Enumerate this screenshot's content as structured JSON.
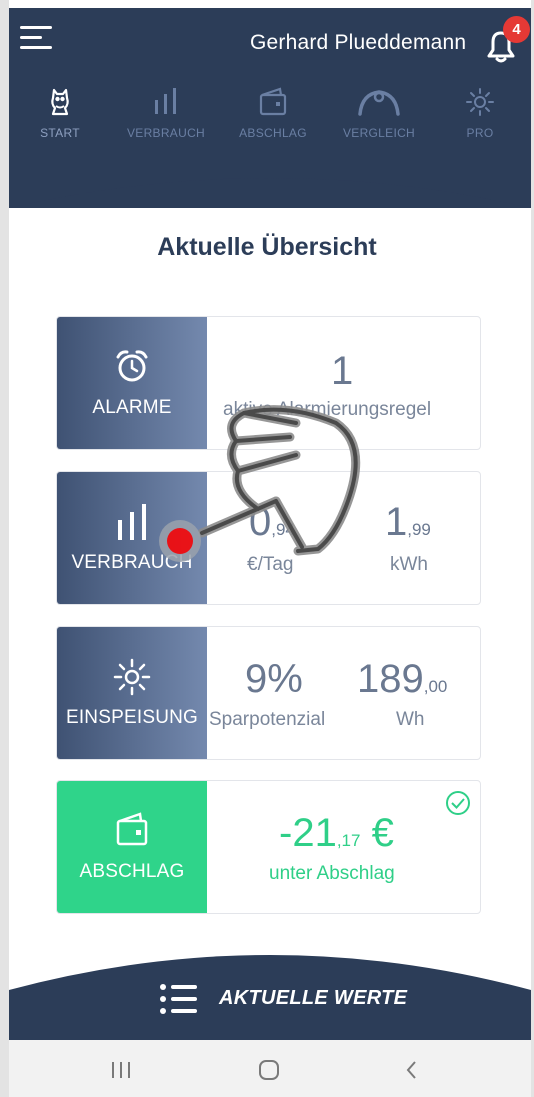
{
  "header": {
    "user_name": "Gerhard Plueddemann",
    "notification_count": "4"
  },
  "nav": {
    "items": [
      {
        "label": "START",
        "icon": "owl-icon"
      },
      {
        "label": "VERBRAUCH",
        "icon": "bar-chart-icon"
      },
      {
        "label": "ABSCHLAG",
        "icon": "wallet-icon"
      },
      {
        "label": "VERGLEICH",
        "icon": "gauge-icon"
      },
      {
        "label": "PRO",
        "icon": "sun-icon"
      }
    ]
  },
  "page_title": "Aktuelle Übersicht",
  "cards": {
    "alarme": {
      "label": "ALARME",
      "icon": "alarm-clock-icon",
      "value": "1",
      "caption": "aktive Alarmierungsregel"
    },
    "verbrauch": {
      "label": "VERBRAUCH",
      "icon": "bar-chart-icon",
      "cost_main": "0",
      "cost_fraction": ",94",
      "cost_unit": "€/Tag",
      "energy_main": "1",
      "energy_fraction": ",99",
      "energy_unit": "kWh"
    },
    "einspeisung": {
      "label": "EINSPEISUNG",
      "icon": "sun-icon",
      "percent": "9%",
      "percent_caption": "Sparpotenzial",
      "energy_main": "189",
      "energy_fraction": ",00",
      "energy_unit": "Wh"
    },
    "abschlag": {
      "label": "ABSCHLAG",
      "icon": "wallet-icon",
      "amount_main": "-21",
      "amount_fraction": ",17",
      "amount_currency": " €",
      "caption": "unter Abschlag",
      "status_icon": "check-circle-icon"
    }
  },
  "bottom_bar": {
    "label": "AKTUELLE WERTE",
    "icon": "list-icon"
  },
  "colors": {
    "header_bg": "#2c3d58",
    "accent_green": "#2fd48a",
    "card_gradient_start": "#3f5273",
    "card_gradient_end": "#7489ae",
    "badge_red": "#e53935"
  }
}
